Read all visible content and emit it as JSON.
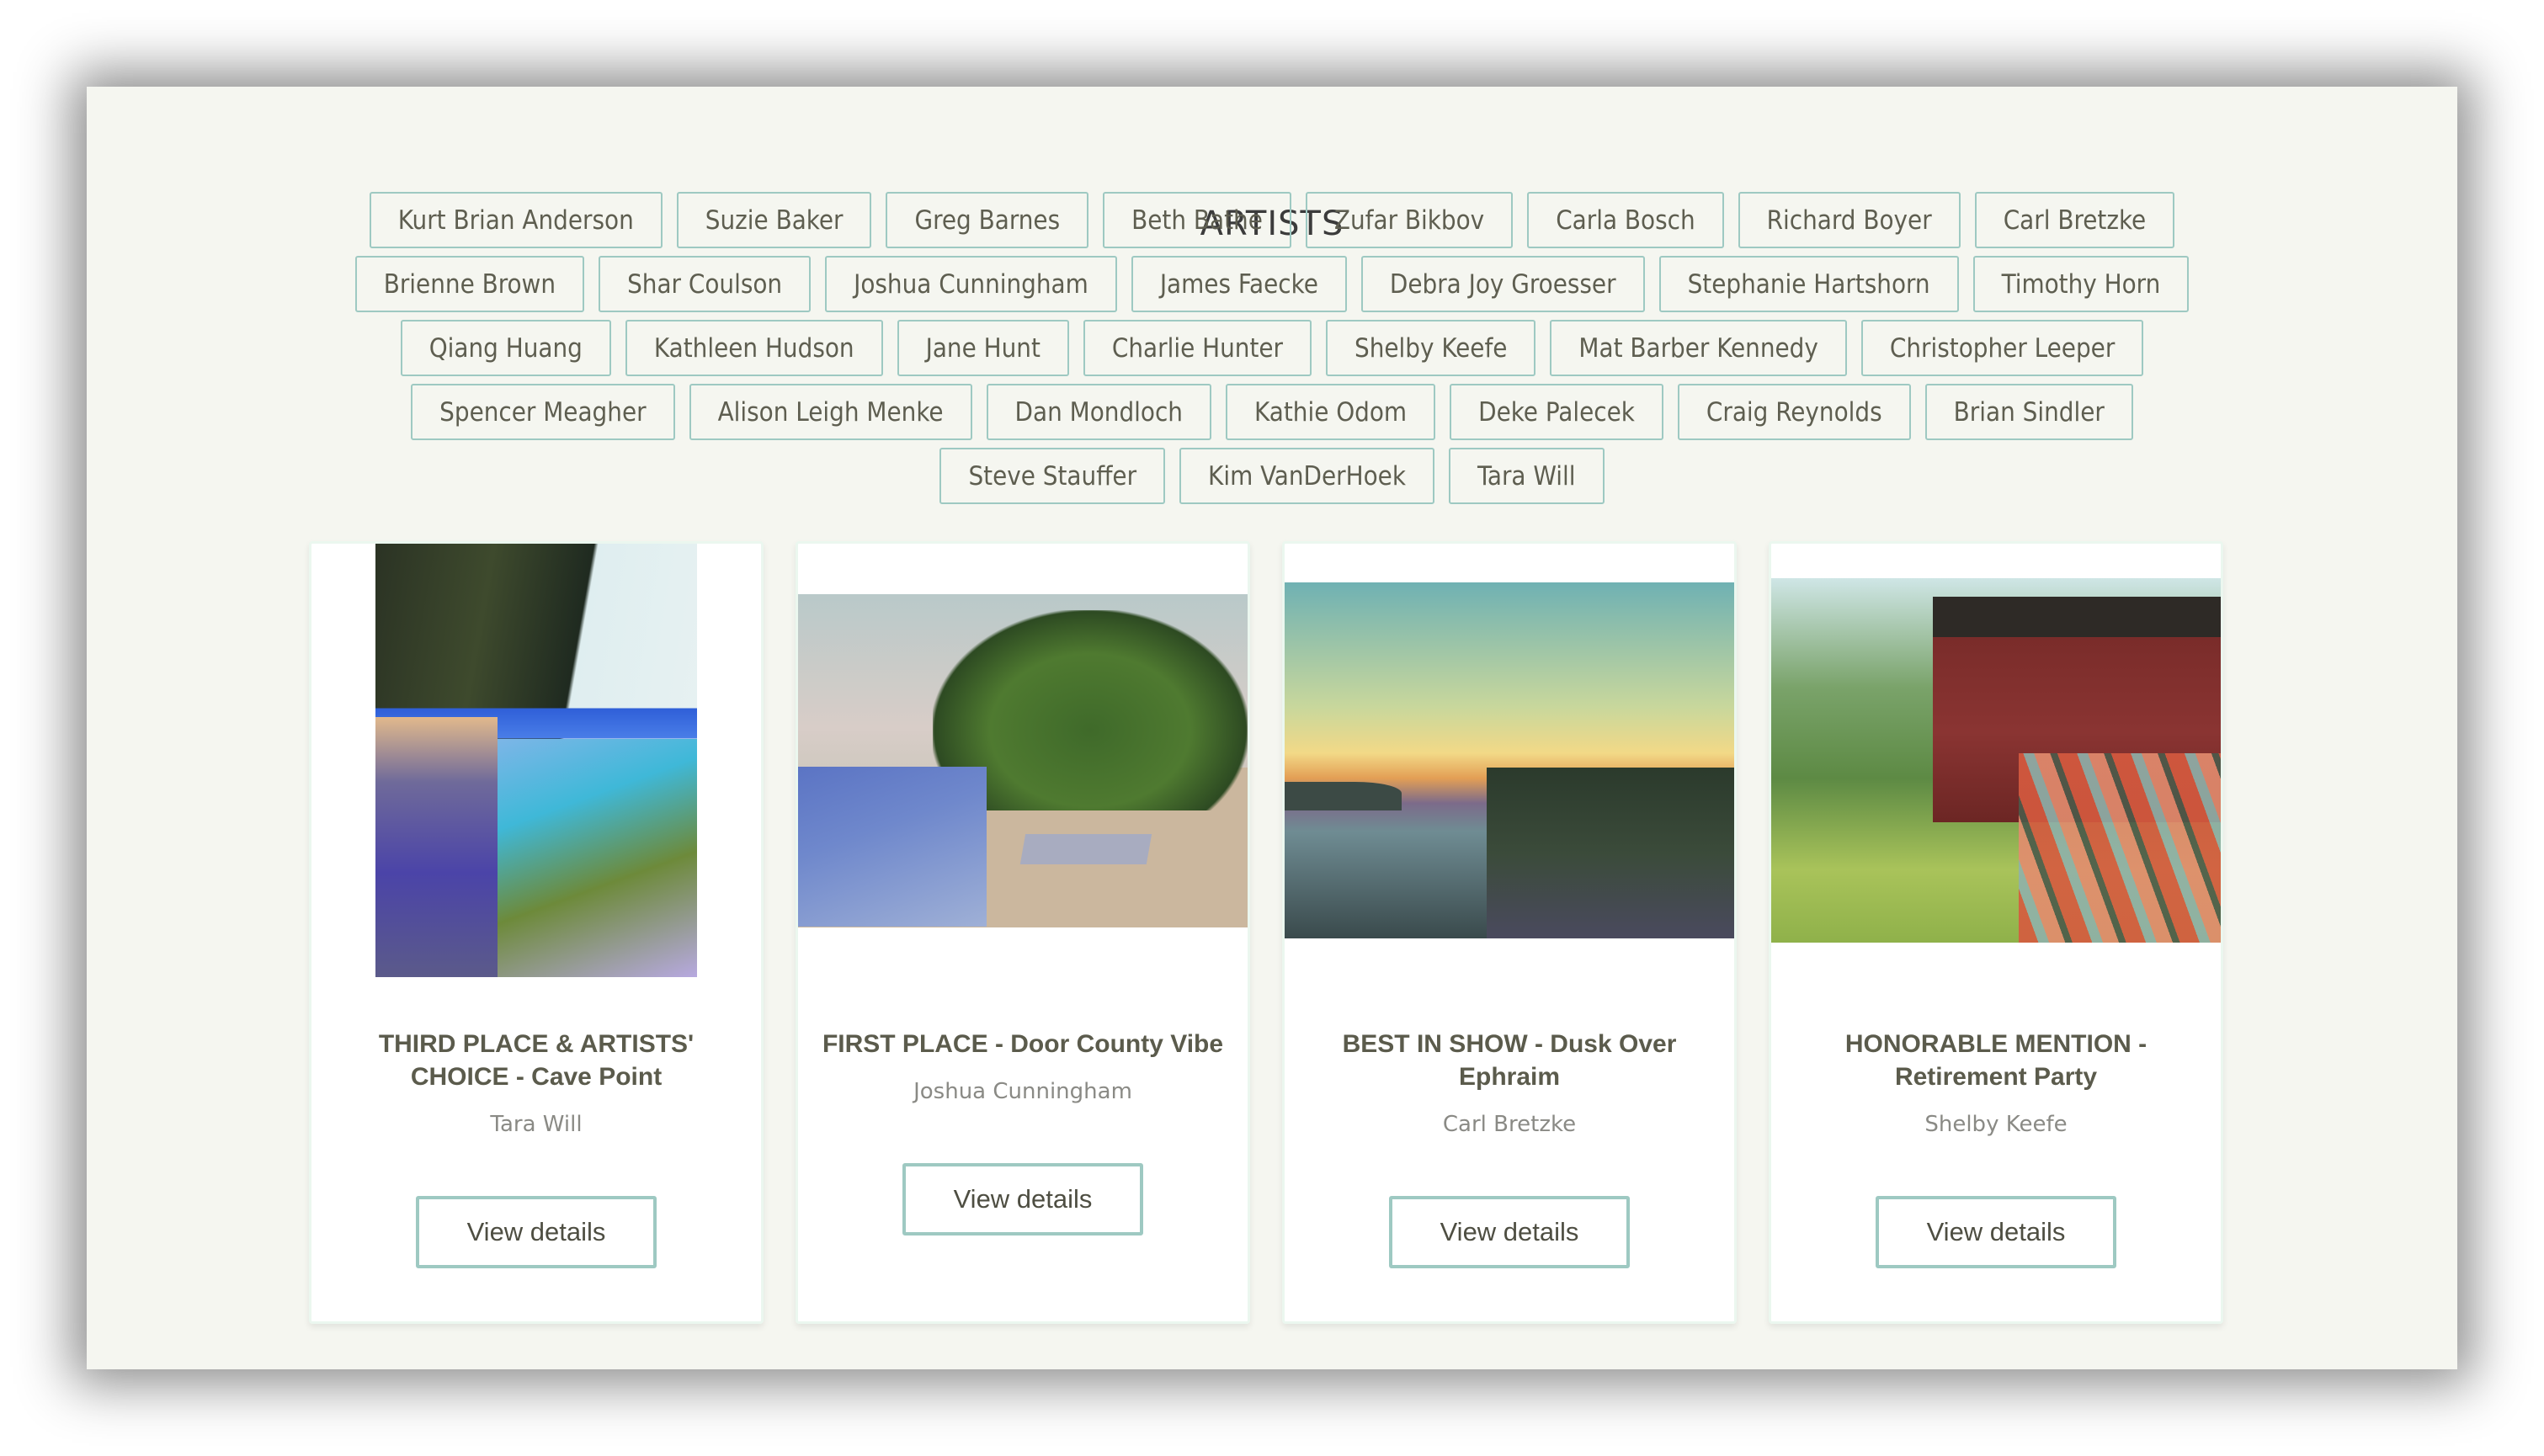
{
  "heading": "ARTISTS",
  "artists": [
    "Kurt Brian Anderson",
    "Suzie Baker",
    "Greg Barnes",
    "Beth Bathe",
    "Zufar Bikbov",
    "Carla Bosch",
    "Richard Boyer",
    "Carl Bretzke",
    "Brienne Brown",
    "Shar Coulson",
    "Joshua Cunningham",
    "James Faecke",
    "Debra Joy Groesser",
    "Stephanie Hartshorn",
    "Timothy Horn",
    "Qiang Huang",
    "Kathleen Hudson",
    "Jane Hunt",
    "Charlie Hunter",
    "Shelby Keefe",
    "Mat Barber Kennedy",
    "Christopher Leeper",
    "Spencer Meagher",
    "Alison Leigh Menke",
    "Dan Mondloch",
    "Kathie Odom",
    "Deke Palecek",
    "Craig Reynolds",
    "Brian Sindler",
    "Steve Stauffer",
    "Kim VanDerHoek",
    "Tara Will"
  ],
  "colors": {
    "background": "#f5f6f0",
    "accent_border": "#9ec9c2",
    "text": "#5e5e50",
    "muted_text": "#8a8a85"
  },
  "cards": [
    {
      "title": "THIRD PLACE & ARTISTS' CHOICE - Cave Point",
      "artist": "Tara Will",
      "button": "View details",
      "image_alt": "painting-cave-point"
    },
    {
      "title": "FIRST PLACE - Door County Vibe",
      "artist": "Joshua Cunningham",
      "button": "View details",
      "image_alt": "painting-door-county-vibe"
    },
    {
      "title": "BEST IN SHOW - Dusk Over Ephraim",
      "artist": "Carl Bretzke",
      "button": "View details",
      "image_alt": "painting-dusk-over-ephraim"
    },
    {
      "title": "HONORABLE MENTION - Retirement Party",
      "artist": "Shelby Keefe",
      "button": "View details",
      "image_alt": "painting-retirement-party"
    }
  ]
}
